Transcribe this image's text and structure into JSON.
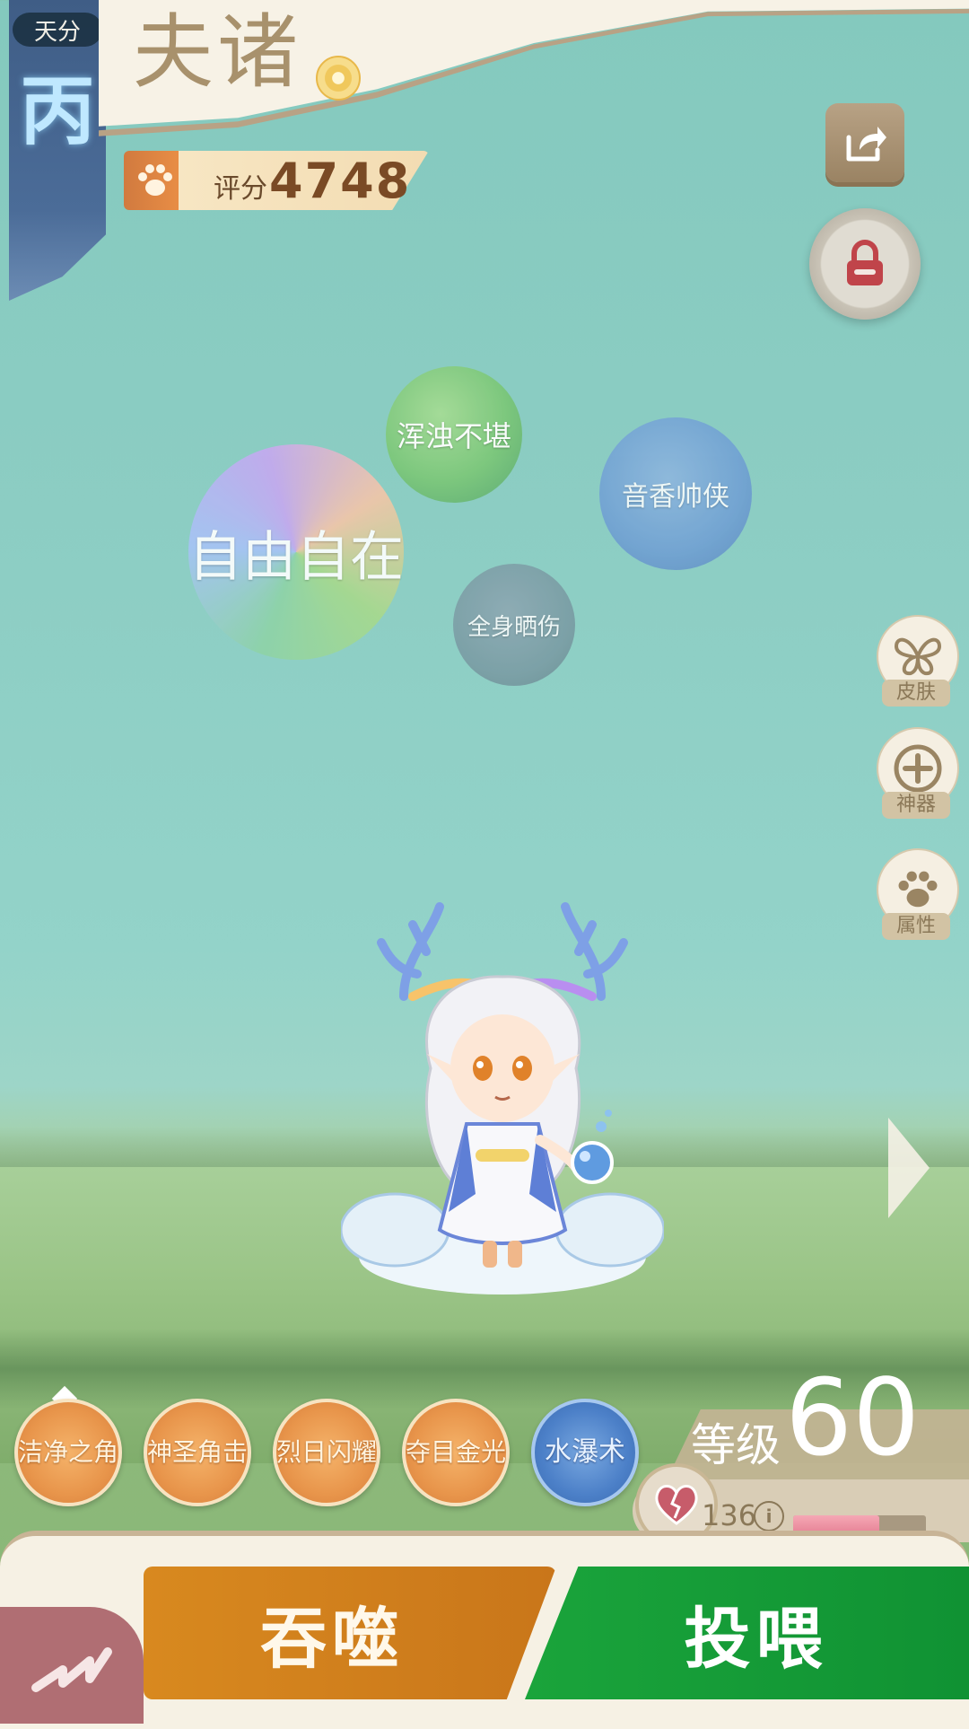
{
  "grade": {
    "label": "天分",
    "value": "丙"
  },
  "pet": {
    "name": "夫诸"
  },
  "score": {
    "label": "评分",
    "value": "4748"
  },
  "bubbles": [
    "浑浊不堪",
    "音香帅侠",
    "自由自在",
    "全身晒伤"
  ],
  "side_menu": {
    "skin": "皮肤",
    "artifact": "神器",
    "attributes": "属性"
  },
  "skills": [
    "洁净之角",
    "神圣角击",
    "烈日闪耀",
    "夺目金光",
    "水瀑术"
  ],
  "level": {
    "label": "等级",
    "value": "60"
  },
  "hp": {
    "value": "136",
    "fill_fraction": 0.65
  },
  "actions": {
    "devour": "吞噬",
    "feed": "投喂"
  },
  "colors": {
    "devour": "#c9761a",
    "feed": "#109233",
    "grade": "#4b6c98"
  }
}
